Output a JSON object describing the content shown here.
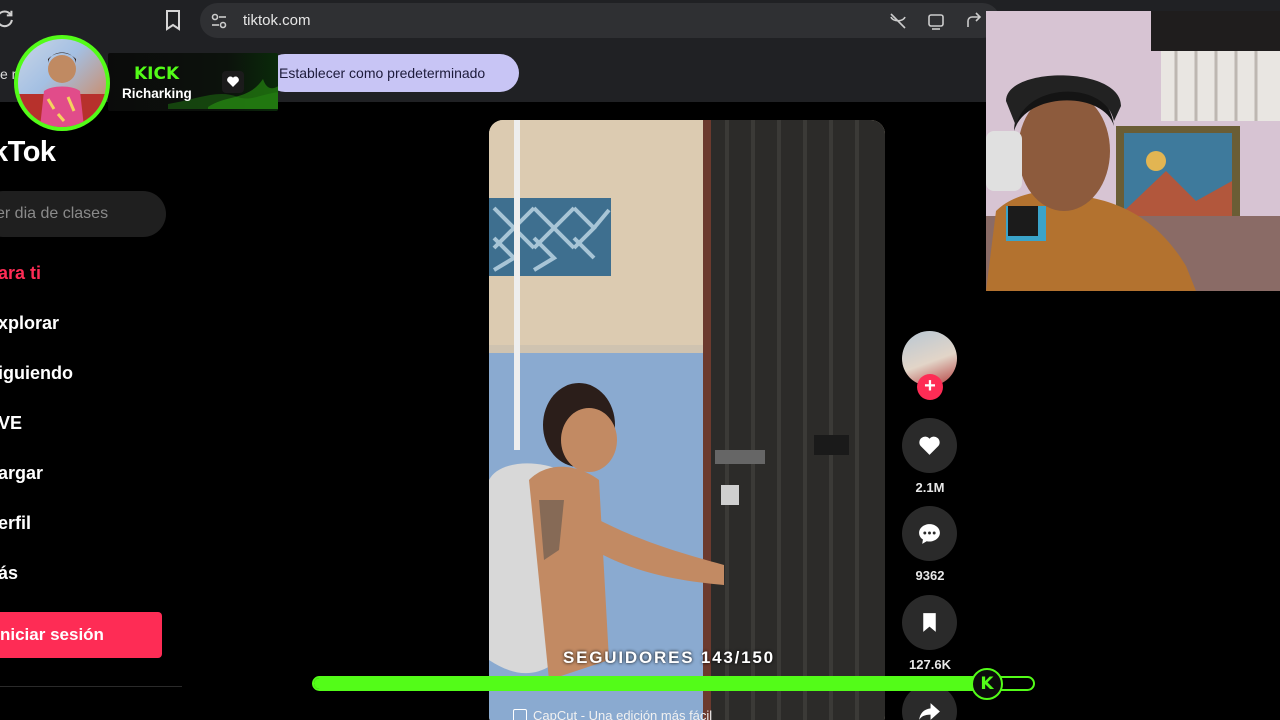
{
  "browser": {
    "url": "tiktok.com",
    "banner_left_text": "e r",
    "default_button_label": "Establecer como predeterminado"
  },
  "kick": {
    "logo_text": "KICK",
    "username": "Richarking",
    "accent_color": "#53fc18"
  },
  "tiktok": {
    "logo_text": "kTok",
    "search_placeholder": "er dia de clases",
    "nav": [
      {
        "label": "ara ti",
        "active": true
      },
      {
        "label": "xplorar",
        "active": false
      },
      {
        "label": "iguiendo",
        "active": false
      },
      {
        "label": "VE",
        "active": false
      },
      {
        "label": "argar",
        "active": false
      },
      {
        "label": "erfil",
        "active": false
      },
      {
        "label": "ás",
        "active": false
      }
    ],
    "login_label": "niciar sesión",
    "brand_color": "#fe2c55"
  },
  "video": {
    "watermark": "CapCut - Una edición más fácil",
    "follow_plus": "+"
  },
  "actions": {
    "likes": "2.1M",
    "comments": "9362",
    "saves": "127.6K"
  },
  "goal": {
    "label": "SEGUIDORES 143/150",
    "current": 143,
    "target": 150,
    "knob_text": "K"
  }
}
